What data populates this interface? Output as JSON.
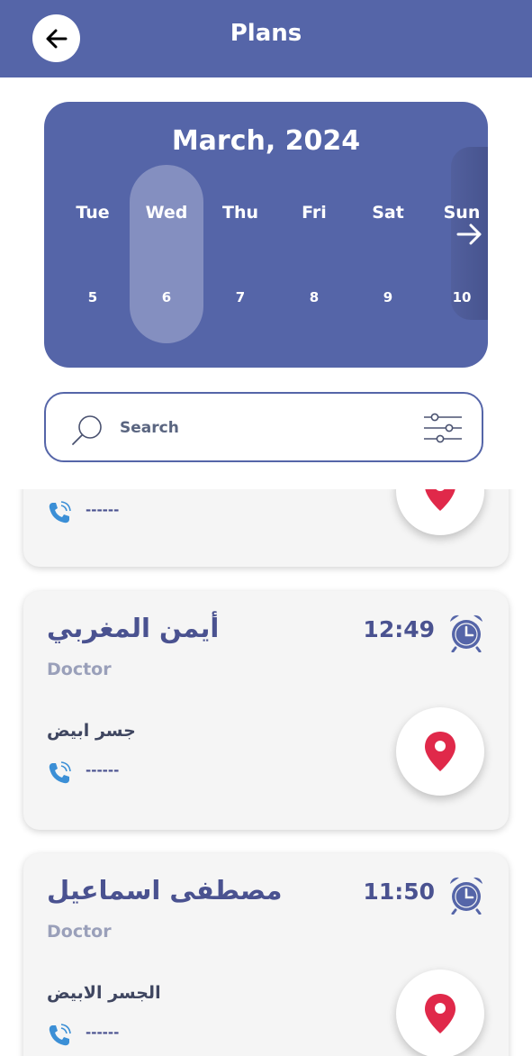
{
  "header": {
    "title": "Plans",
    "back_icon": "arrow-left-icon"
  },
  "calendar": {
    "title": "March, 2024",
    "selected_index": 1,
    "days": [
      {
        "name": "Tue",
        "num": "5"
      },
      {
        "name": "Wed",
        "num": "6"
      },
      {
        "name": "Thu",
        "num": "7"
      },
      {
        "name": "Fri",
        "num": "8"
      },
      {
        "name": "Sat",
        "num": "9"
      },
      {
        "name": "Sun",
        "num": "10"
      }
    ],
    "next_icon": "arrow-right-icon"
  },
  "search": {
    "placeholder": "Search",
    "icon": "search-icon",
    "filter_icon": "sliders-icon"
  },
  "plans": [
    {
      "name": "",
      "role": "",
      "time": "",
      "address": "",
      "phone": "------"
    },
    {
      "name": "أيمن المغربي",
      "role": "Doctor",
      "time": "12:49",
      "address": "جسر ابيض",
      "phone": "------"
    },
    {
      "name": "مصطفى اسماعيل",
      "role": "Doctor",
      "time": "11:50",
      "address": "الجسر الابيض",
      "phone": "------"
    }
  ],
  "colors": {
    "primary": "#5565a8",
    "pin": "#e0294a",
    "phone": "#3b8fd6",
    "card": "#f5f5f5"
  }
}
